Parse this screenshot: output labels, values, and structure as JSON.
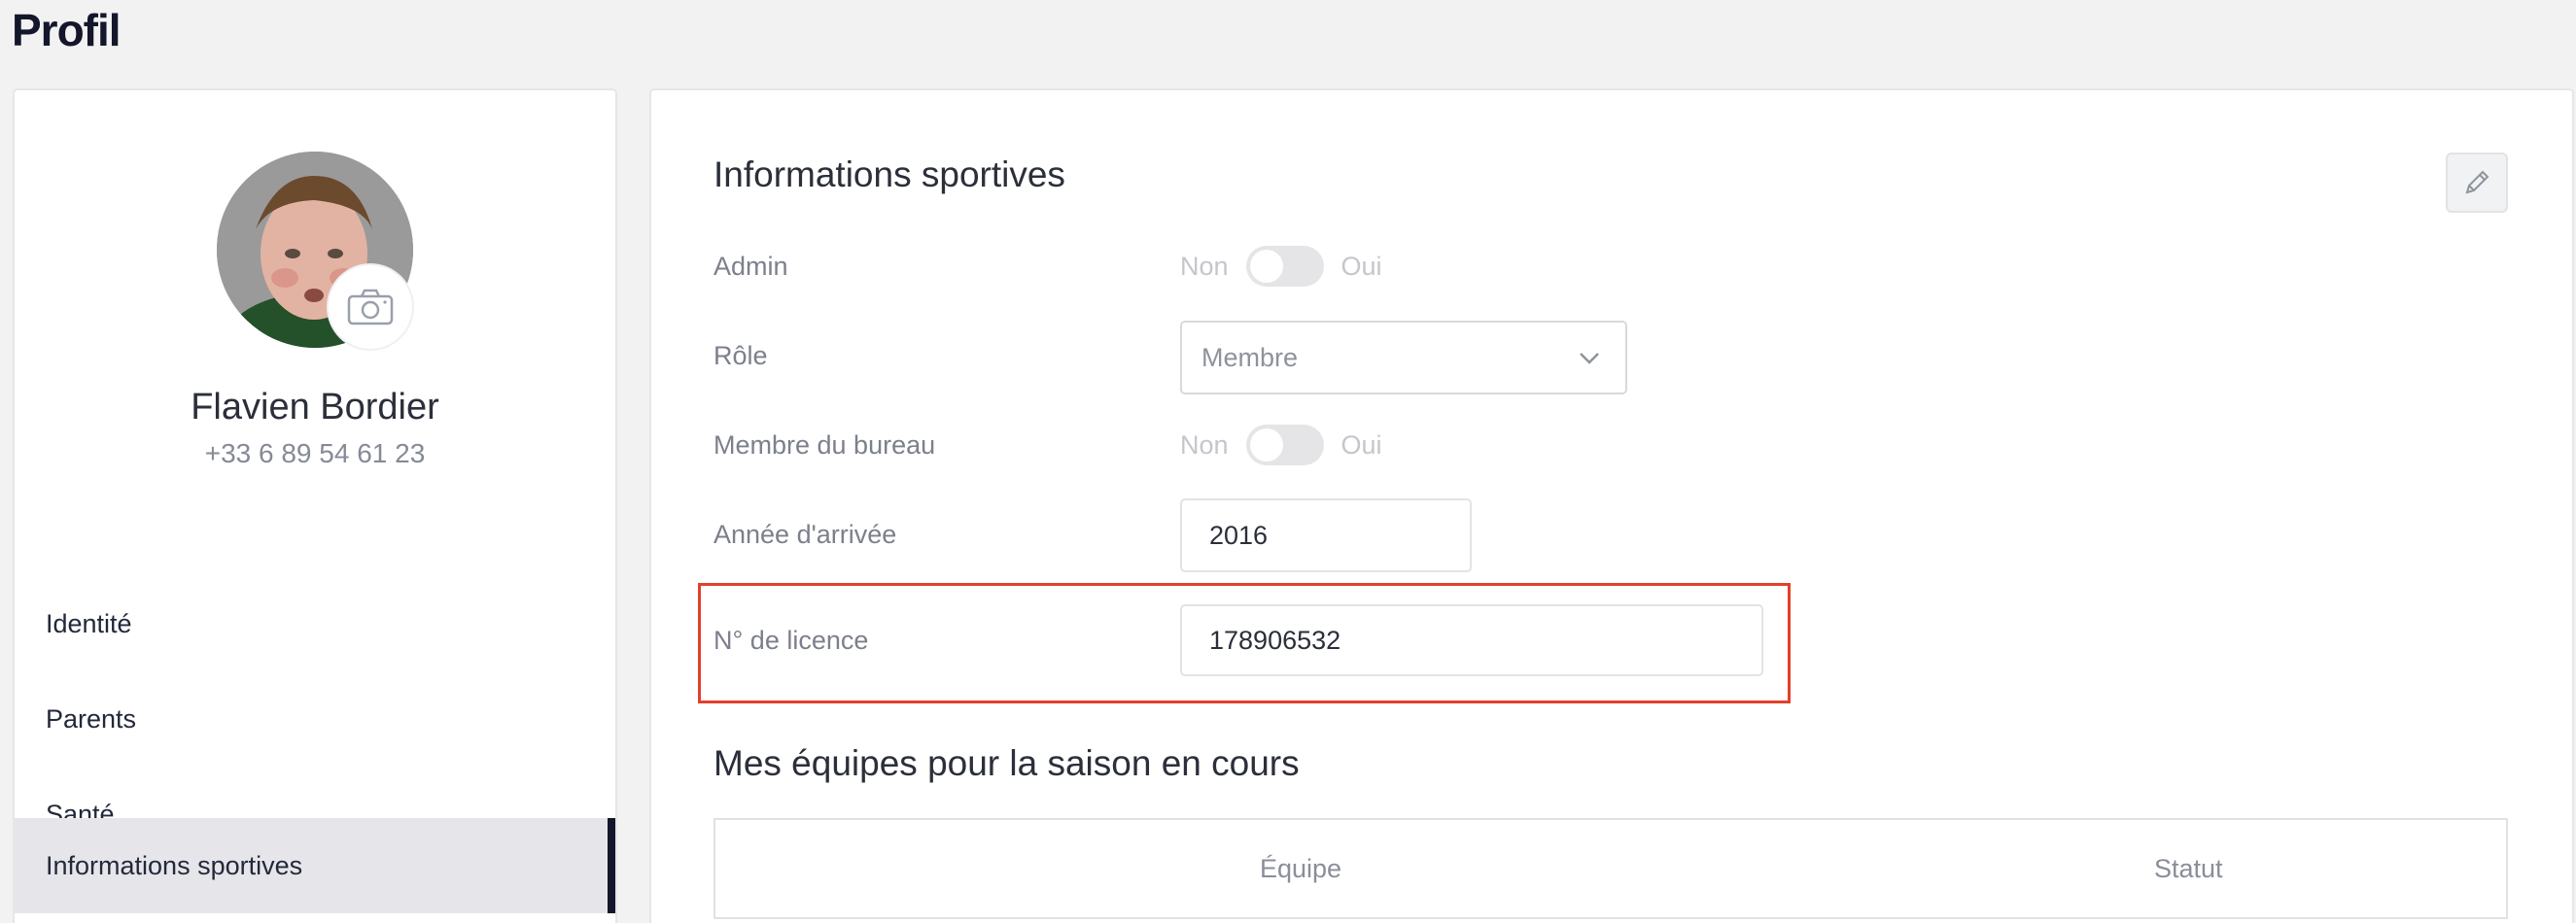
{
  "page": {
    "title": "Profil"
  },
  "profile": {
    "name": "Flavien Bordier",
    "phone": "+33 6 89 54 61 23"
  },
  "nav": {
    "items": [
      {
        "label": "Identité"
      },
      {
        "label": "Parents"
      },
      {
        "label": "Santé"
      },
      {
        "label": "Informations sportives"
      }
    ],
    "active": "Informations sportives"
  },
  "sports": {
    "title": "Informations sportives",
    "admin": {
      "label": "Admin",
      "off": "Non",
      "on": "Oui",
      "value": false
    },
    "role": {
      "label": "Rôle",
      "value": "Membre"
    },
    "bureau": {
      "label": "Membre du bureau",
      "off": "Non",
      "on": "Oui",
      "value": false
    },
    "arrival": {
      "label": "Année d'arrivée",
      "value": "2016"
    },
    "licence": {
      "label": "N° de licence",
      "value": "178906532"
    }
  },
  "teams": {
    "title": "Mes équipes pour la saison en cours",
    "columns": [
      "Équipe",
      "Statut"
    ]
  },
  "colors": {
    "highlight": "#e2402a",
    "accent": "#14172b"
  },
  "icons": {
    "camera": "camera-icon",
    "edit": "pencil-icon",
    "dropdown": "chevron-down-icon"
  }
}
